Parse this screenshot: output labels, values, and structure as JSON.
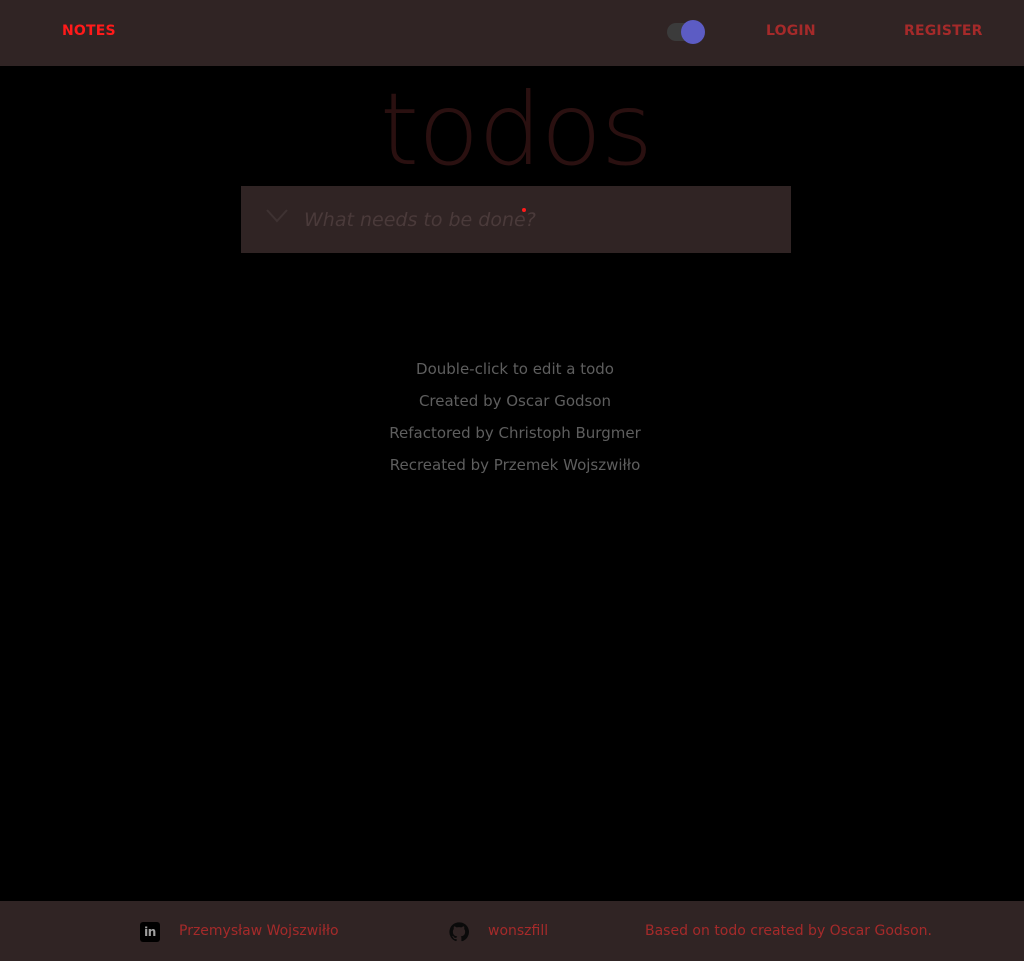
{
  "nav": {
    "brand": "NOTES",
    "login": "LOGIN",
    "register": "REGISTER",
    "theme_toggle_on": true
  },
  "main": {
    "title": "todos",
    "new_todo_placeholder": "What needs to be done?"
  },
  "info": {
    "lines": [
      "Double-click to edit a todo",
      "Created by Oscar Godson",
      "Refactored by Christoph Burgmer",
      "Recreated by Przemek Wojszwiłło"
    ]
  },
  "footer": {
    "author": "Przemysław Wojszwiłło",
    "github": "wonszfill",
    "credit": "Based on todo created by Oscar Godson."
  },
  "icons": {
    "linkedin": "linkedin-icon",
    "github": "github-icon",
    "toggle_all": "chevron-down-icon"
  },
  "colors": {
    "navbar_bg": "#302424",
    "accent_red": "#ff1a1a",
    "link_red": "#a52a2a",
    "toggle_knob": "#5c5cc4"
  }
}
